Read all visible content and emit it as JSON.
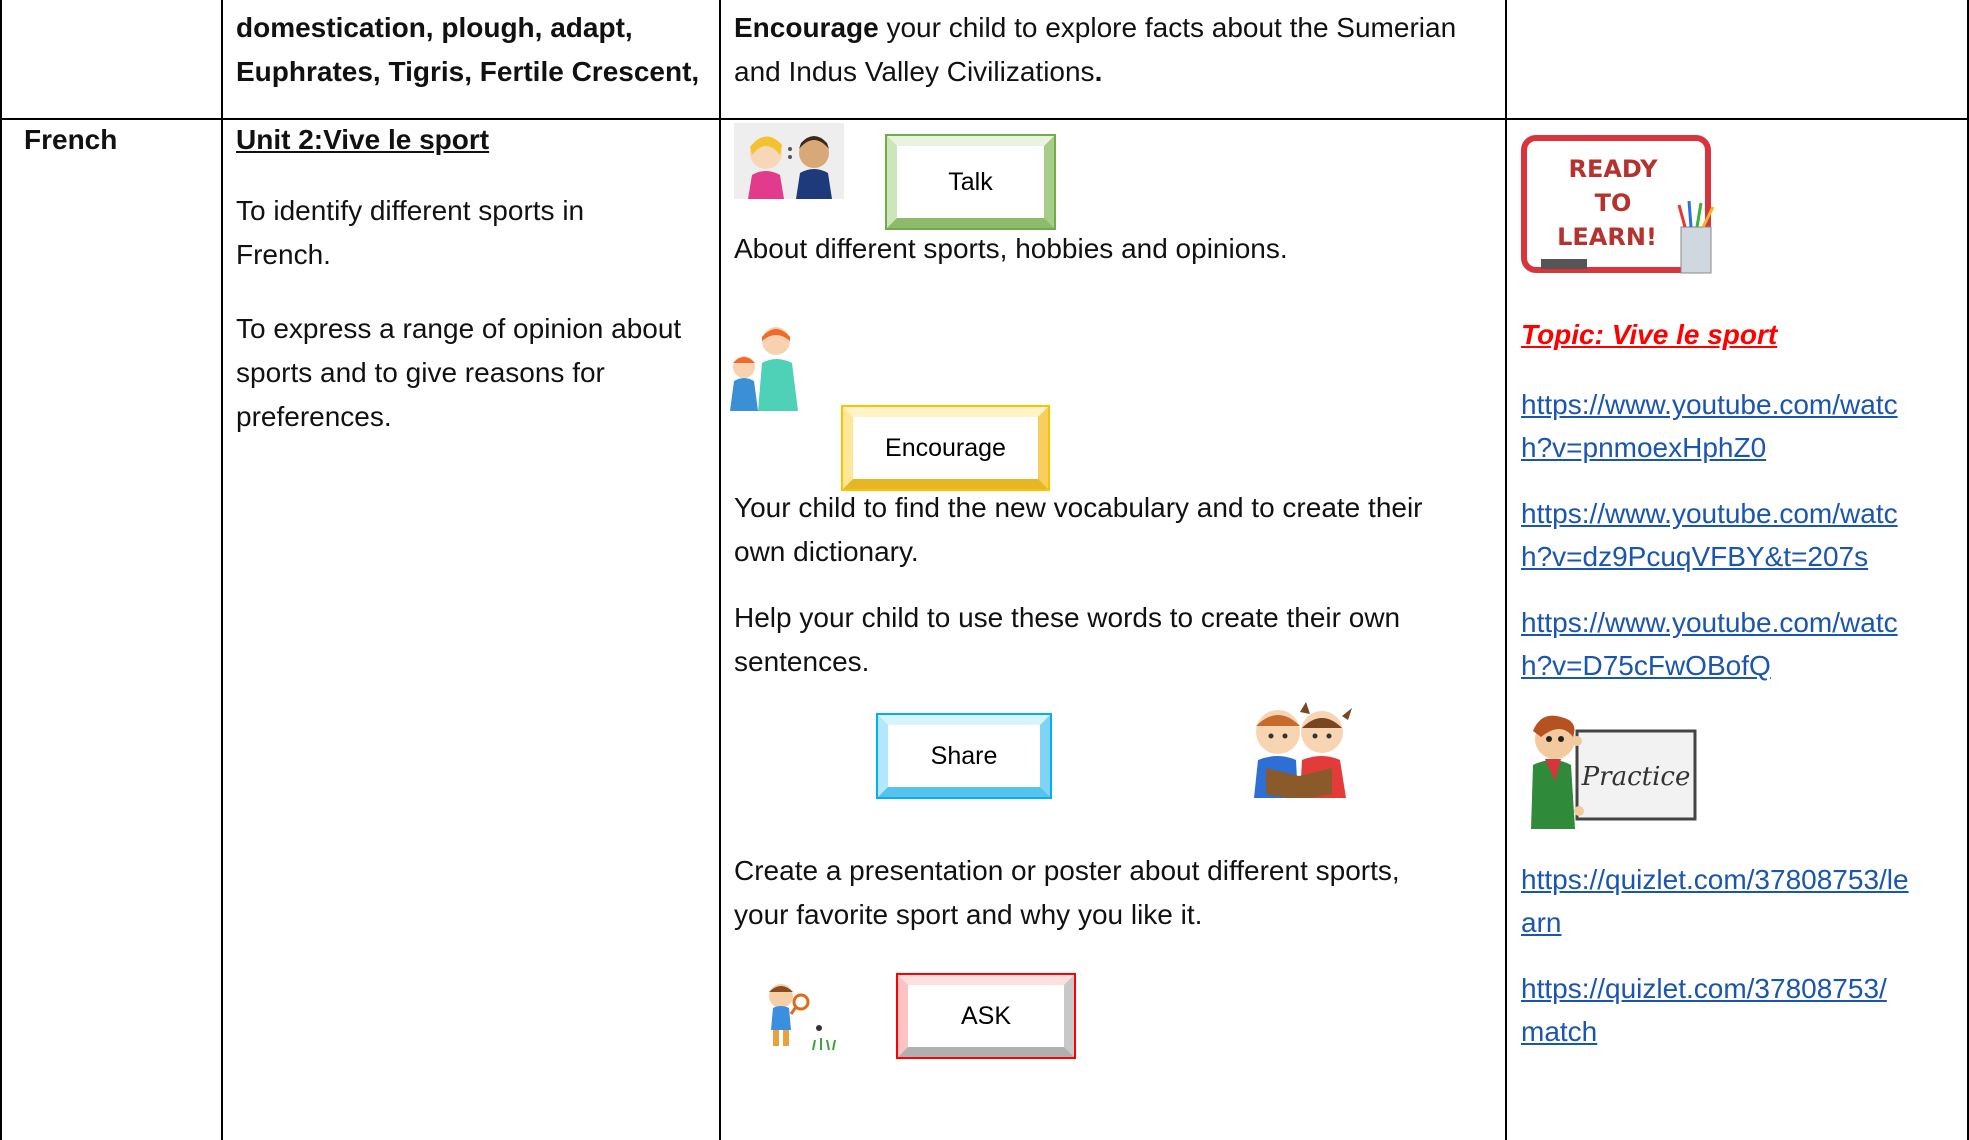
{
  "top_row": {
    "col2_lines": [
      "domestication, plough, adapt,",
      "Euphrates, Tigris, Fertile Crescent,"
    ],
    "col3_bold": "Encourage",
    "col3_line1": " your child to explore facts about the Sumerian",
    "col3_line2": "and Indus Valley Civilizations",
    "col3_period": "."
  },
  "french_row": {
    "subject": "French",
    "unit_title": "Unit 2:Vive le sport",
    "objective1_lines": [
      "To identify different sports in",
      "French."
    ],
    "objective2_lines": [
      "To express a range of opinion about",
      "sports and to give reasons for",
      "preferences."
    ],
    "talk_label": "Talk",
    "talk_text": "About different sports, hobbies and opinions.",
    "encourage_label": "Encourage",
    "encourage_lines": [
      "Your child to find the new vocabulary and to create their",
      "own dictionary."
    ],
    "help_lines": [
      "Help your child to use these words to create their own",
      "sentences."
    ],
    "share_label": "Share",
    "create_lines": [
      "Create a presentation or poster about different sports,",
      "your favorite sport and why you like it."
    ],
    "ask_label": "ASK",
    "ready_sign": [
      "READY",
      "TO",
      "LEARN!"
    ],
    "topic_label": "Topic: Vive le sport",
    "links": [
      [
        "https://www.youtube.com/watc",
        "h?v=pnmoexHphZ0"
      ],
      [
        "https://www.youtube.com/watc",
        "h?v=dz9PcuqVFBY&t=207s"
      ],
      [
        "https://www.youtube.com/watc",
        "h?v=D75cFwOBofQ"
      ]
    ],
    "practice_sign": "Practice",
    "links2": [
      [
        "https://quizlet.com/37808753/le",
        "arn"
      ],
      [
        "https://quizlet.com/37808753/",
        "match"
      ]
    ]
  },
  "colors": {
    "talk_border": "#70ad47",
    "encourage_border": "#ffc000",
    "share_border": "#00b0f0",
    "ask_border": "#ff0000",
    "link": "#1a55b0",
    "topic": "#ff0000"
  }
}
